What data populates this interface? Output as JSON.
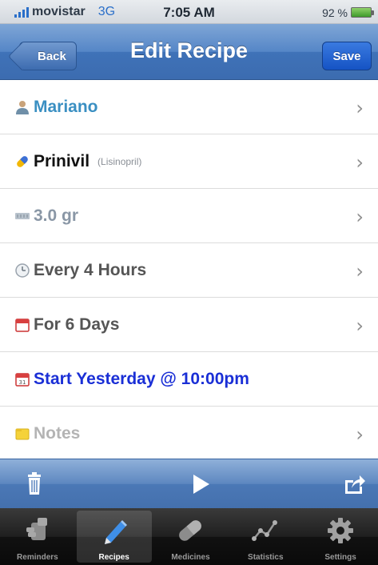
{
  "status_bar": {
    "carrier": "movistar",
    "network": "3G",
    "time": "7:05 AM",
    "battery": "92 %"
  },
  "nav": {
    "back_label": "Back",
    "title": "Edit Recipe",
    "save_label": "Save"
  },
  "rows": [
    {
      "label": "Mariano",
      "sub": "",
      "icon": "person-icon",
      "has_chevron": true
    },
    {
      "label": "Prinivil",
      "sub": "(Lisinopril)",
      "icon": "pill-icon",
      "has_chevron": true
    },
    {
      "label": "3.0 gr",
      "sub": "",
      "icon": "dose-icon",
      "has_chevron": true
    },
    {
      "label": "Every 4 Hours",
      "sub": "",
      "icon": "clock-icon",
      "has_chevron": true
    },
    {
      "label": "For 6 Days",
      "sub": "",
      "icon": "calendar-icon",
      "has_chevron": true
    },
    {
      "label": "Start Yesterday @ 10:00pm",
      "sub": "",
      "icon": "calendar-start-icon",
      "has_chevron": false
    },
    {
      "label": "Notes",
      "sub": "",
      "icon": "notes-icon",
      "has_chevron": true
    }
  ],
  "toolbar": {
    "icons": [
      "trash-icon",
      "play-icon",
      "share-icon"
    ]
  },
  "tabs": [
    {
      "label": "Reminders",
      "icon": "reminders-icon",
      "active": false
    },
    {
      "label": "Recipes",
      "icon": "pencil-icon",
      "active": true
    },
    {
      "label": "Medicines",
      "icon": "capsule-icon",
      "active": false
    },
    {
      "label": "Statistics",
      "icon": "chart-icon",
      "active": false
    },
    {
      "label": "Settings",
      "icon": "gear-icon",
      "active": false
    }
  ],
  "colors": {
    "nav_blue": "#3c6cb0",
    "accent_blue": "#1a2fd6",
    "person_blue": "#3a8fc2"
  }
}
